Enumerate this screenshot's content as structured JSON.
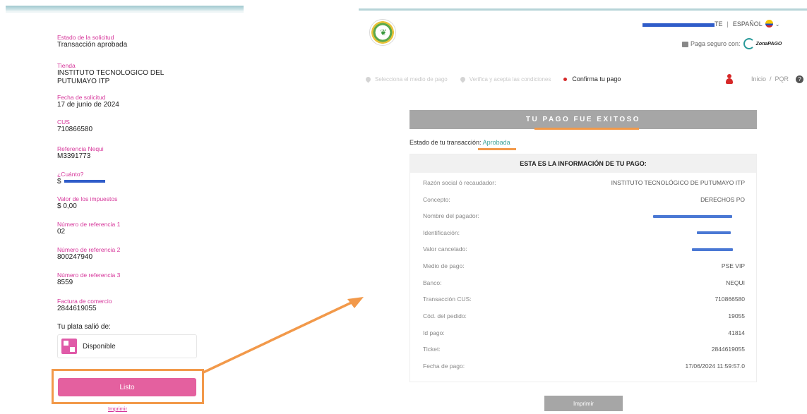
{
  "nequi": {
    "fields": [
      {
        "label": "Estado de la solicitud",
        "value": "Transacción aprobada"
      },
      {
        "label": "Tienda",
        "value": "INSTITUTO TECNOLOGICO DEL PUTUMAYO ITP"
      },
      {
        "label": "Fecha de solicitud",
        "value": "17 de junio de 2024"
      },
      {
        "label": "CUS",
        "value": "710866580"
      },
      {
        "label": "Referencia Nequi",
        "value": "M3391773"
      },
      {
        "label": "¿Cuánto?",
        "value": "$"
      },
      {
        "label": "Valor de los impuestos",
        "value": "$ 0,00"
      },
      {
        "label": "Número de referencia 1",
        "value": "02"
      },
      {
        "label": "Número de referencia 2",
        "value": "800247940"
      },
      {
        "label": "Número de referencia 3",
        "value": "8559"
      },
      {
        "label": "Factura de comercio",
        "value": "2844619055"
      }
    ],
    "source_label": "Tu plata salió de:",
    "source_value": "Disponible",
    "done_button": "Listo",
    "print_link": "Imprimir"
  },
  "pse": {
    "header": {
      "user_suffix": "TE",
      "language": "ESPAÑOL",
      "secure_text": "Paga seguro con:",
      "brand": "ZonaPAGO"
    },
    "steps": [
      {
        "label": "Selecciona el medio de pago",
        "state": "done"
      },
      {
        "label": "Verifica y acepta las condiciones",
        "state": "done"
      },
      {
        "label": "Confirma tu pago",
        "state": "active"
      }
    ],
    "nav": {
      "inicio": "Inicio",
      "sep": "/",
      "pqr": "PQR"
    },
    "banner": "TU PAGO FUE EXITOSO",
    "status_label": "Estado de tu transacción:",
    "status_value": "Aprobada",
    "info_title": "ESTA ES LA INFORMACIÓN DE TU PAGO:",
    "rows": [
      {
        "key": "Razón social ó recaudador:",
        "value": "INSTITUTO TECNOLÓGICO DE PUTUMAYO ITP"
      },
      {
        "key": "Concepto:",
        "value": "DERECHOS PO"
      },
      {
        "key": "Nombre del pagador:",
        "value": ""
      },
      {
        "key": "Identificación:",
        "value": ""
      },
      {
        "key": "Valor cancelado:",
        "value": ""
      },
      {
        "key": "Medio de pago:",
        "value": "PSE VIP"
      },
      {
        "key": "Banco:",
        "value": "NEQUI"
      },
      {
        "key": "Transacción CUS:",
        "value": "710866580"
      },
      {
        "key": "Cód. del pedido:",
        "value": "19055"
      },
      {
        "key": "Id pago:",
        "value": "41814"
      },
      {
        "key": "Ticket:",
        "value": "2844619055"
      },
      {
        "key": "Fecha de pago:",
        "value": "17/06/2024 11:59:57.0"
      }
    ],
    "print_button": "Imprimir"
  },
  "colors": {
    "nequi_pink": "#d6359a",
    "button_pink": "#e4609f",
    "highlight_orange": "#f2994a",
    "approved_teal": "#3fa49a",
    "redaction_blue": "#2f5cc9"
  }
}
